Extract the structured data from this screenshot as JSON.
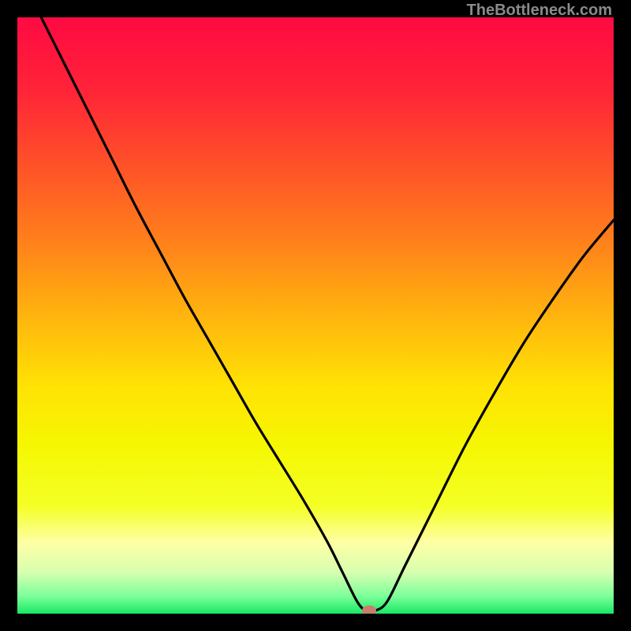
{
  "watermark": "TheBottleneck.com",
  "chart_data": {
    "type": "line",
    "title": "",
    "xlabel": "",
    "ylabel": "",
    "x_range": [
      0,
      100
    ],
    "y_range": [
      0,
      100
    ],
    "series": [
      {
        "name": "bottleneck-curve",
        "x": [
          4,
          8,
          12,
          16,
          20,
          24,
          28,
          32,
          36,
          40,
          44,
          48,
          52,
          54.5,
          57,
          58.5,
          60,
          62,
          65,
          70,
          75,
          80,
          85,
          90,
          95,
          100
        ],
        "values": [
          100,
          92,
          84,
          76,
          68,
          60.5,
          53,
          46,
          39,
          32,
          25.5,
          19,
          12,
          7,
          2,
          0.5,
          0.5,
          2,
          8,
          18,
          28,
          37,
          45.5,
          53,
          60,
          66
        ],
        "color": "#000000"
      }
    ],
    "marker": {
      "x": 59,
      "y": 0.5,
      "color": "#c97e6f"
    },
    "background_gradient": {
      "stops": [
        {
          "pos": 0.0,
          "color": "#ff0a42"
        },
        {
          "pos": 0.12,
          "color": "#ff2338"
        },
        {
          "pos": 0.25,
          "color": "#ff5228"
        },
        {
          "pos": 0.38,
          "color": "#ff821a"
        },
        {
          "pos": 0.5,
          "color": "#ffb40e"
        },
        {
          "pos": 0.62,
          "color": "#ffe304"
        },
        {
          "pos": 0.72,
          "color": "#f5f702"
        },
        {
          "pos": 0.82,
          "color": "#f4ff26"
        },
        {
          "pos": 0.88,
          "color": "#feffa4"
        },
        {
          "pos": 0.93,
          "color": "#d8ffb0"
        },
        {
          "pos": 0.97,
          "color": "#7eff9b"
        },
        {
          "pos": 1.0,
          "color": "#18e964"
        }
      ]
    }
  }
}
